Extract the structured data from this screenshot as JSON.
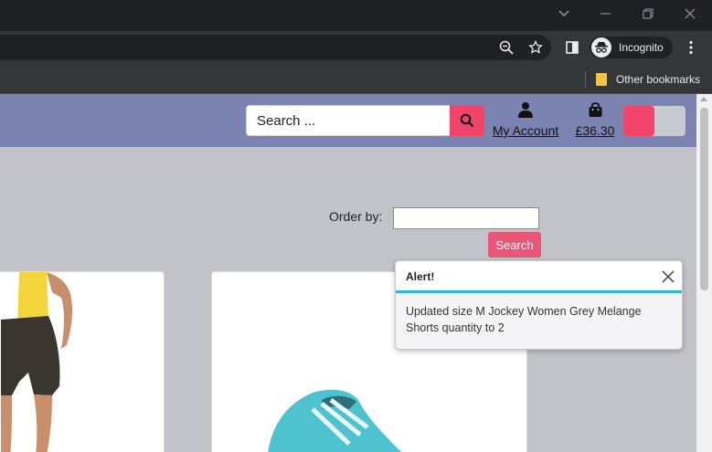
{
  "browser": {
    "profile_label": "Incognito",
    "bookmarks": {
      "other_label": "Other bookmarks"
    }
  },
  "header": {
    "search_placeholder": "Search ...",
    "account_label": "My Account",
    "cart_total": "£36.30"
  },
  "listing": {
    "order_by_label": "Order by:",
    "search_button_label": "Search"
  },
  "alert": {
    "title": "Alert!",
    "message": "Updated size M Jockey Women Grey Melange Shorts quantity to 2"
  },
  "colors": {
    "accent": "#f2446a",
    "header_bg": "#7b83b1",
    "alert_border": "#2bbad4"
  }
}
